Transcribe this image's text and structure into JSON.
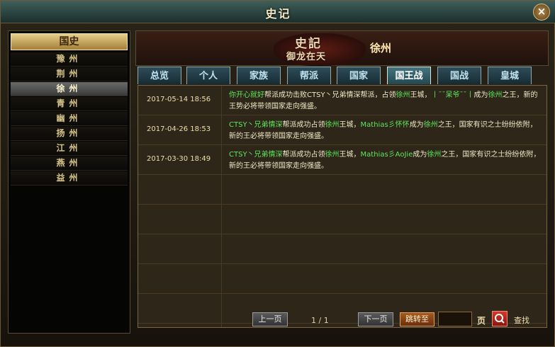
{
  "window": {
    "title": "史记",
    "close_label": "×"
  },
  "left": {
    "category": "国史",
    "provinces": [
      {
        "label": "豫州",
        "active": false
      },
      {
        "label": "荆州",
        "active": false
      },
      {
        "label": "徐州",
        "active": true
      },
      {
        "label": "青州",
        "active": false
      },
      {
        "label": "幽州",
        "active": false
      },
      {
        "label": "扬州",
        "active": false
      },
      {
        "label": "江州",
        "active": false
      },
      {
        "label": "燕州",
        "active": false
      },
      {
        "label": "益州",
        "active": false
      }
    ]
  },
  "banner": {
    "logo_top": "史記",
    "logo_bottom": "御龙在天",
    "region": "徐州"
  },
  "tabs": [
    {
      "label": "总览",
      "active": false
    },
    {
      "label": "个人",
      "active": false
    },
    {
      "label": "家族",
      "active": false
    },
    {
      "label": "帮派",
      "active": false
    },
    {
      "label": "国家",
      "active": false
    },
    {
      "label": "国王战",
      "active": true
    },
    {
      "label": "国战",
      "active": false
    },
    {
      "label": "皇城",
      "active": false
    }
  ],
  "records": [
    {
      "time": "2017-05-14 18:56",
      "segments": [
        {
          "t": "你开心就好",
          "g": true
        },
        {
          "t": "帮派成功击败",
          "g": false
        },
        {
          "t": "CTSY丶兄弟情深",
          "g": false
        },
        {
          "t": "帮派，占领",
          "g": false
        },
        {
          "t": "徐州",
          "g": true
        },
        {
          "t": "王城，",
          "g": false
        },
        {
          "t": "丨ˉˉ呆爷ˉˉ丨",
          "g": true
        },
        {
          "t": "成为",
          "g": false
        },
        {
          "t": "徐州",
          "g": true
        },
        {
          "t": "之王，新的王势必将带领国家走向强盛。",
          "g": false
        }
      ]
    },
    {
      "time": "2017-04-26 18:53",
      "segments": [
        {
          "t": "CTSY丶兄弟情深",
          "g": true
        },
        {
          "t": "帮派成功占领",
          "g": false
        },
        {
          "t": "徐州",
          "g": true
        },
        {
          "t": "王城，",
          "g": false
        },
        {
          "t": "Mathias彡怀怀",
          "g": true
        },
        {
          "t": "成为",
          "g": false
        },
        {
          "t": "徐州",
          "g": true
        },
        {
          "t": "之王，国家有识之士纷纷依附，新的王必将带领国家走向强盛。",
          "g": false
        }
      ]
    },
    {
      "time": "2017-03-30 18:49",
      "segments": [
        {
          "t": "CTSY丶兄弟情深",
          "g": true
        },
        {
          "t": "帮派成功占领",
          "g": false
        },
        {
          "t": "徐州",
          "g": true
        },
        {
          "t": "王城，",
          "g": false
        },
        {
          "t": "Mathias彡AoJie",
          "g": true
        },
        {
          "t": "成为",
          "g": false
        },
        {
          "t": "徐州",
          "g": true
        },
        {
          "t": "之王，国家有识之士纷纷依附，新的王必将带领国家走向强盛。",
          "g": false
        }
      ]
    }
  ],
  "pager": {
    "prev": "上一页",
    "info": "1 / 1",
    "next": "下一页",
    "jump": "跳转至",
    "input": "",
    "page_label": "页",
    "search": "查找"
  },
  "colors": {
    "highlight": "#5ee65e",
    "active_tab": "#45757f",
    "gold": "#e7cf8a"
  }
}
